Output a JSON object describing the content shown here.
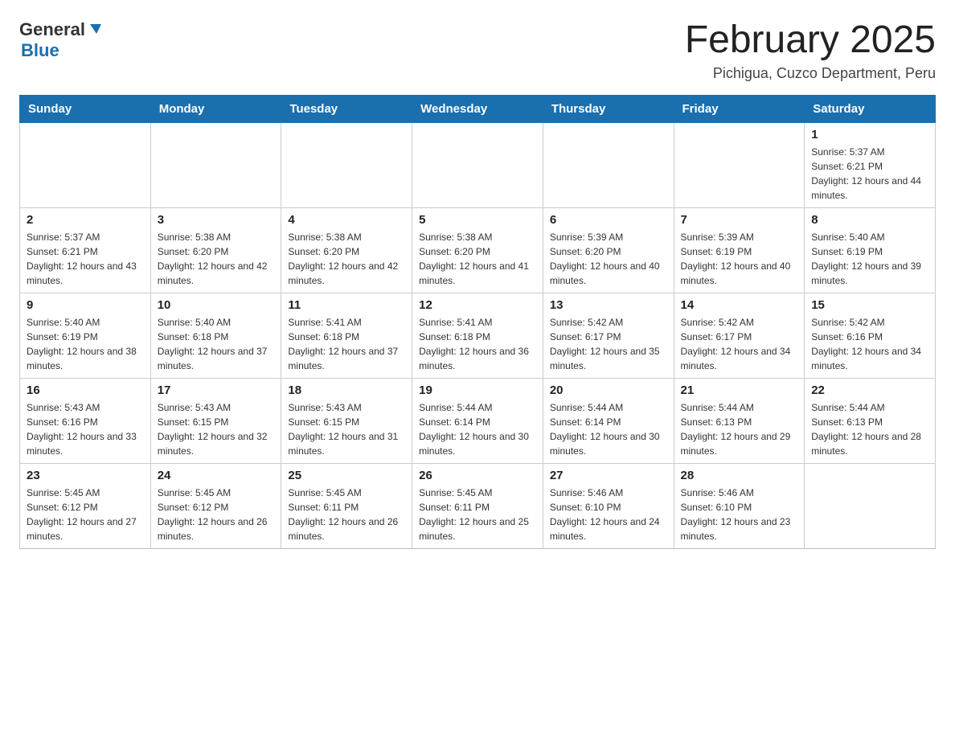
{
  "header": {
    "logo": {
      "general": "General",
      "blue": "Blue",
      "aria": "GeneralBlue logo"
    },
    "title": "February 2025",
    "subtitle": "Pichigua, Cuzco Department, Peru"
  },
  "calendar": {
    "weekdays": [
      "Sunday",
      "Monday",
      "Tuesday",
      "Wednesday",
      "Thursday",
      "Friday",
      "Saturday"
    ],
    "weeks": [
      [
        {
          "day": "",
          "info": ""
        },
        {
          "day": "",
          "info": ""
        },
        {
          "day": "",
          "info": ""
        },
        {
          "day": "",
          "info": ""
        },
        {
          "day": "",
          "info": ""
        },
        {
          "day": "",
          "info": ""
        },
        {
          "day": "1",
          "info": "Sunrise: 5:37 AM\nSunset: 6:21 PM\nDaylight: 12 hours and 44 minutes."
        }
      ],
      [
        {
          "day": "2",
          "info": "Sunrise: 5:37 AM\nSunset: 6:21 PM\nDaylight: 12 hours and 43 minutes."
        },
        {
          "day": "3",
          "info": "Sunrise: 5:38 AM\nSunset: 6:20 PM\nDaylight: 12 hours and 42 minutes."
        },
        {
          "day": "4",
          "info": "Sunrise: 5:38 AM\nSunset: 6:20 PM\nDaylight: 12 hours and 42 minutes."
        },
        {
          "day": "5",
          "info": "Sunrise: 5:38 AM\nSunset: 6:20 PM\nDaylight: 12 hours and 41 minutes."
        },
        {
          "day": "6",
          "info": "Sunrise: 5:39 AM\nSunset: 6:20 PM\nDaylight: 12 hours and 40 minutes."
        },
        {
          "day": "7",
          "info": "Sunrise: 5:39 AM\nSunset: 6:19 PM\nDaylight: 12 hours and 40 minutes."
        },
        {
          "day": "8",
          "info": "Sunrise: 5:40 AM\nSunset: 6:19 PM\nDaylight: 12 hours and 39 minutes."
        }
      ],
      [
        {
          "day": "9",
          "info": "Sunrise: 5:40 AM\nSunset: 6:19 PM\nDaylight: 12 hours and 38 minutes."
        },
        {
          "day": "10",
          "info": "Sunrise: 5:40 AM\nSunset: 6:18 PM\nDaylight: 12 hours and 37 minutes."
        },
        {
          "day": "11",
          "info": "Sunrise: 5:41 AM\nSunset: 6:18 PM\nDaylight: 12 hours and 37 minutes."
        },
        {
          "day": "12",
          "info": "Sunrise: 5:41 AM\nSunset: 6:18 PM\nDaylight: 12 hours and 36 minutes."
        },
        {
          "day": "13",
          "info": "Sunrise: 5:42 AM\nSunset: 6:17 PM\nDaylight: 12 hours and 35 minutes."
        },
        {
          "day": "14",
          "info": "Sunrise: 5:42 AM\nSunset: 6:17 PM\nDaylight: 12 hours and 34 minutes."
        },
        {
          "day": "15",
          "info": "Sunrise: 5:42 AM\nSunset: 6:16 PM\nDaylight: 12 hours and 34 minutes."
        }
      ],
      [
        {
          "day": "16",
          "info": "Sunrise: 5:43 AM\nSunset: 6:16 PM\nDaylight: 12 hours and 33 minutes."
        },
        {
          "day": "17",
          "info": "Sunrise: 5:43 AM\nSunset: 6:15 PM\nDaylight: 12 hours and 32 minutes."
        },
        {
          "day": "18",
          "info": "Sunrise: 5:43 AM\nSunset: 6:15 PM\nDaylight: 12 hours and 31 minutes."
        },
        {
          "day": "19",
          "info": "Sunrise: 5:44 AM\nSunset: 6:14 PM\nDaylight: 12 hours and 30 minutes."
        },
        {
          "day": "20",
          "info": "Sunrise: 5:44 AM\nSunset: 6:14 PM\nDaylight: 12 hours and 30 minutes."
        },
        {
          "day": "21",
          "info": "Sunrise: 5:44 AM\nSunset: 6:13 PM\nDaylight: 12 hours and 29 minutes."
        },
        {
          "day": "22",
          "info": "Sunrise: 5:44 AM\nSunset: 6:13 PM\nDaylight: 12 hours and 28 minutes."
        }
      ],
      [
        {
          "day": "23",
          "info": "Sunrise: 5:45 AM\nSunset: 6:12 PM\nDaylight: 12 hours and 27 minutes."
        },
        {
          "day": "24",
          "info": "Sunrise: 5:45 AM\nSunset: 6:12 PM\nDaylight: 12 hours and 26 minutes."
        },
        {
          "day": "25",
          "info": "Sunrise: 5:45 AM\nSunset: 6:11 PM\nDaylight: 12 hours and 26 minutes."
        },
        {
          "day": "26",
          "info": "Sunrise: 5:45 AM\nSunset: 6:11 PM\nDaylight: 12 hours and 25 minutes."
        },
        {
          "day": "27",
          "info": "Sunrise: 5:46 AM\nSunset: 6:10 PM\nDaylight: 12 hours and 24 minutes."
        },
        {
          "day": "28",
          "info": "Sunrise: 5:46 AM\nSunset: 6:10 PM\nDaylight: 12 hours and 23 minutes."
        },
        {
          "day": "",
          "info": ""
        }
      ]
    ]
  }
}
